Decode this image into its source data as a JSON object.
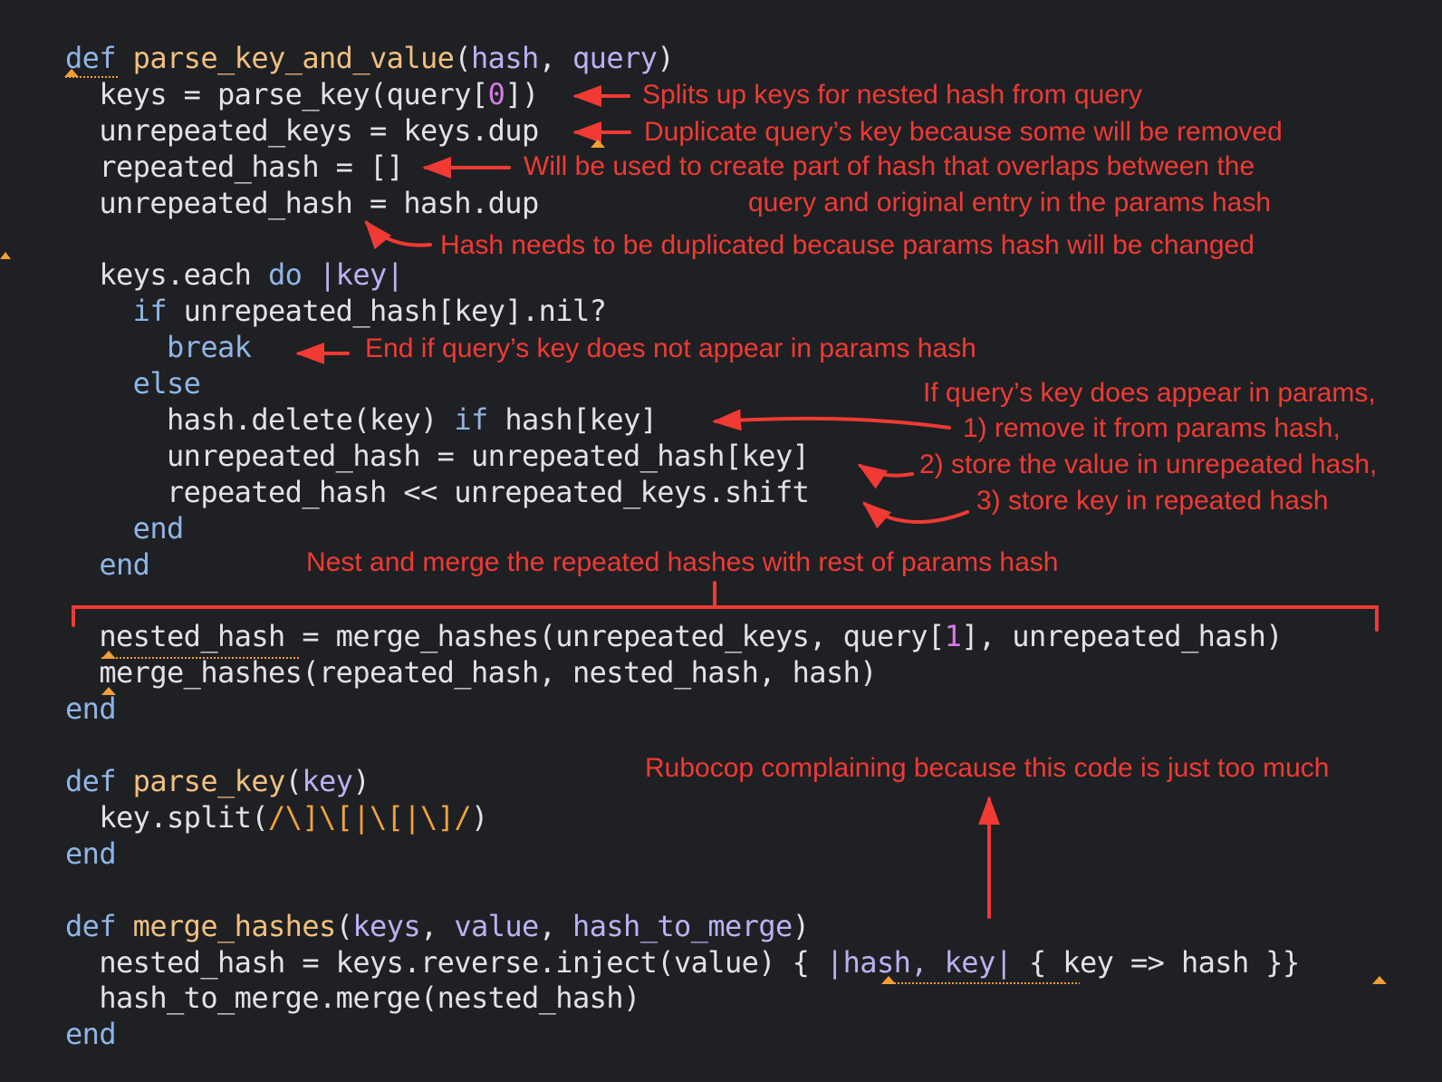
{
  "colors": {
    "background": "#1f2023",
    "code_text": "#e1e2e4",
    "keyword": "#8fb5e6",
    "function_name": "#f0c080",
    "parameter": "#b9b3f3",
    "number": "#d77be4",
    "regex": "#f2a23c",
    "annotation": "#f13a34",
    "lint_marker": "#f29f36"
  },
  "code": [
    {
      "id": "l1",
      "tokens": [
        {
          "t": "def",
          "c": "kw"
        },
        {
          "t": " "
        },
        {
          "t": "parse_key_and_value",
          "c": "fn"
        },
        {
          "t": "("
        },
        {
          "t": "hash",
          "c": "par"
        },
        {
          "t": ", "
        },
        {
          "t": "query",
          "c": "par"
        },
        {
          "t": ")"
        }
      ]
    },
    {
      "id": "l2",
      "tokens": [
        {
          "t": "  keys = parse_key(query["
        },
        {
          "t": "0",
          "c": "num"
        },
        {
          "t": "])"
        }
      ]
    },
    {
      "id": "l3",
      "tokens": [
        {
          "t": "  unrepeated_keys = keys.dup"
        }
      ]
    },
    {
      "id": "l4",
      "tokens": [
        {
          "t": "  repeated_hash = []"
        }
      ]
    },
    {
      "id": "l5",
      "tokens": [
        {
          "t": "  unrepeated_hash = hash.dup"
        }
      ]
    },
    {
      "id": "l6",
      "tokens": [
        {
          "t": ""
        }
      ]
    },
    {
      "id": "l7",
      "tokens": [
        {
          "t": "  keys.each "
        },
        {
          "t": "do",
          "c": "kw"
        },
        {
          "t": " "
        },
        {
          "t": "|key|",
          "c": "par"
        }
      ]
    },
    {
      "id": "l8",
      "tokens": [
        {
          "t": "    "
        },
        {
          "t": "if",
          "c": "kw"
        },
        {
          "t": " unrepeated_hash[key].nil?"
        }
      ]
    },
    {
      "id": "l9",
      "tokens": [
        {
          "t": "      "
        },
        {
          "t": "break",
          "c": "kw"
        }
      ]
    },
    {
      "id": "l10",
      "tokens": [
        {
          "t": "    "
        },
        {
          "t": "else",
          "c": "kw"
        }
      ]
    },
    {
      "id": "l11",
      "tokens": [
        {
          "t": "      hash.delete(key) "
        },
        {
          "t": "if",
          "c": "kw"
        },
        {
          "t": " hash[key]"
        }
      ]
    },
    {
      "id": "l12",
      "tokens": [
        {
          "t": "      unrepeated_hash = unrepeated_hash[key]"
        }
      ]
    },
    {
      "id": "l13",
      "tokens": [
        {
          "t": "      repeated_hash << unrepeated_keys.shift"
        }
      ]
    },
    {
      "id": "l14",
      "tokens": [
        {
          "t": "    "
        },
        {
          "t": "end",
          "c": "kw"
        }
      ]
    },
    {
      "id": "l15",
      "tokens": [
        {
          "t": "  "
        },
        {
          "t": "end",
          "c": "kw"
        }
      ]
    },
    {
      "id": "l16",
      "tokens": [
        {
          "t": ""
        }
      ]
    },
    {
      "id": "l17",
      "tokens": [
        {
          "t": "  nested_hash = merge_hashes(unrepeated_keys, query["
        },
        {
          "t": "1",
          "c": "num"
        },
        {
          "t": "], unrepeated_hash)"
        }
      ]
    },
    {
      "id": "l18",
      "tokens": [
        {
          "t": "  merge_hashes(repeated_hash, nested_hash, hash)"
        }
      ]
    },
    {
      "id": "l19",
      "tokens": [
        {
          "t": "end",
          "c": "kw"
        }
      ]
    },
    {
      "id": "l20",
      "tokens": [
        {
          "t": ""
        }
      ]
    },
    {
      "id": "l21",
      "tokens": [
        {
          "t": "def",
          "c": "kw"
        },
        {
          "t": " "
        },
        {
          "t": "parse_key",
          "c": "fn"
        },
        {
          "t": "("
        },
        {
          "t": "key",
          "c": "par"
        },
        {
          "t": ")"
        }
      ]
    },
    {
      "id": "l22",
      "tokens": [
        {
          "t": "  key.split("
        },
        {
          "t": "/\\]\\[|\\[|\\]/",
          "c": "rx"
        },
        {
          "t": ")"
        }
      ]
    },
    {
      "id": "l23",
      "tokens": [
        {
          "t": "end",
          "c": "kw"
        }
      ]
    },
    {
      "id": "l24",
      "tokens": [
        {
          "t": ""
        }
      ]
    },
    {
      "id": "l25",
      "tokens": [
        {
          "t": "def",
          "c": "kw"
        },
        {
          "t": " "
        },
        {
          "t": "merge_hashes",
          "c": "fn"
        },
        {
          "t": "("
        },
        {
          "t": "keys",
          "c": "par"
        },
        {
          "t": ", "
        },
        {
          "t": "value",
          "c": "par"
        },
        {
          "t": ", "
        },
        {
          "t": "hash_to_merge",
          "c": "par"
        },
        {
          "t": ")"
        }
      ]
    },
    {
      "id": "l26",
      "tokens": [
        {
          "t": "  nested_hash = keys.reverse.inject(value) { "
        },
        {
          "t": "|hash, key|",
          "c": "par"
        },
        {
          "t": " { key => hash }}"
        }
      ]
    },
    {
      "id": "l27",
      "tokens": [
        {
          "t": "  hash_to_merge.merge(nested_hash)"
        }
      ]
    },
    {
      "id": "l28",
      "tokens": [
        {
          "t": "end",
          "c": "kw"
        }
      ]
    }
  ],
  "annotations": {
    "splits_keys": "Splits up keys for nested hash from query",
    "duplicate_keys": "Duplicate query’s key because some will be removed",
    "repeated_hash_1": "Will be used to create part of hash that overlaps between the",
    "repeated_hash_2": "query and original entry in the params hash",
    "hash_duplicated": "Hash needs to be duplicated because params hash will be changed",
    "end_if": "End if query’s key does not appear in params hash",
    "if_appears": "If query’s key does appear in params,",
    "step1": "1) remove it from params hash,",
    "step2": "2) store the value in unrepeated hash,",
    "step3": "3) store key in repeated hash",
    "nest_merge": "Nest and merge the repeated hashes with rest of params hash",
    "rubocop": "Rubocop complaining because this code is just too much"
  }
}
